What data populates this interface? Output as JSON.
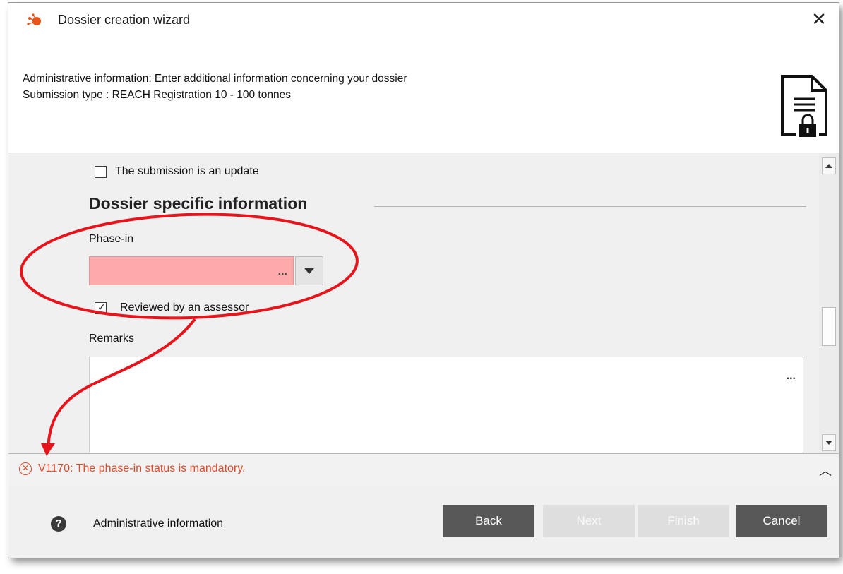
{
  "window": {
    "title": "Dossier creation wizard",
    "close_icon": "close-icon",
    "app_icon": "molecule-icon"
  },
  "header": {
    "description": "Administrative information: Enter additional information concerning your dossier",
    "submission_type": "Submission type : REACH Registration 10 - 100 tonnes",
    "icon": "document-lock-icon"
  },
  "form": {
    "update_checkbox": {
      "label": "The submission is an update",
      "checked": false
    },
    "section_title": "Dossier specific information",
    "phase_in": {
      "label": "Phase-in",
      "value": "",
      "more_label": "...",
      "invalid": true,
      "error_color": "#ffaaaa"
    },
    "reviewed_checkbox": {
      "label": "Reviewed by an assessor",
      "checked": true
    },
    "remarks": {
      "label": "Remarks",
      "value": "",
      "more_label": "..."
    }
  },
  "message": {
    "text": "V1170: The phase-in status is mandatory.",
    "icon": "error-icon",
    "color": "#e0492a",
    "collapse_icon": "chevron-up-icon"
  },
  "footer": {
    "help_icon": "help-icon",
    "label": "Administrative information",
    "buttons": {
      "back": {
        "label": "Back",
        "enabled": true
      },
      "next": {
        "label": "Next",
        "enabled": false
      },
      "finish": {
        "label": "Finish",
        "enabled": false
      },
      "cancel": {
        "label": "Cancel",
        "enabled": true
      }
    }
  },
  "annotation": {
    "color": "#e8141b"
  }
}
